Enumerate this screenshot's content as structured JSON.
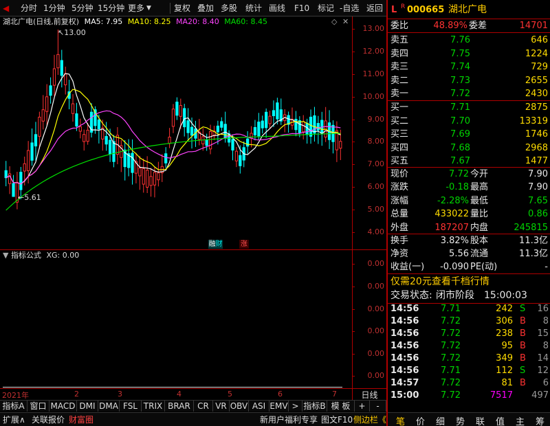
{
  "toolbar": {
    "items": [
      "分时",
      "1分钟",
      "5分钟",
      "15分钟",
      "更多"
    ],
    "right_items": [
      "复权",
      "叠加",
      "多股",
      "统计",
      "画线",
      "F10",
      "标记",
      "-自选",
      "返回"
    ]
  },
  "chart": {
    "title": "湖北广电(日线,前复权)",
    "ma5": "MA5: 7.95",
    "ma10": "MA10: 8.25",
    "ma20": "MA20: 8.40",
    "ma60": "MA60: 8.45",
    "high_label": "13.00",
    "low_label": "5.61",
    "badge_cai": "财",
    "badge_zhang": "涨",
    "yticks": [
      "13.00",
      "12.00",
      "11.00",
      "10.00",
      "9.00",
      "8.00",
      "7.00",
      "6.00",
      "5.00",
      "4.00"
    ],
    "colors": {
      "ma5": "#ffffff",
      "ma10": "#ffff00",
      "ma20": "#ff44ff",
      "ma60": "#00e000",
      "up": "#ff3232",
      "down": "#00ffff"
    }
  },
  "indicator": {
    "title": "指标公式",
    "value": "XG: 0.00",
    "yticks": [
      "0.00",
      "0.00",
      "0.00",
      "0.00",
      "0.00",
      "0.00",
      "0.00"
    ]
  },
  "dates": {
    "labels": [
      "2021年",
      "2",
      "3",
      "4",
      "5",
      "6",
      "7"
    ],
    "period": "日线"
  },
  "tabs": [
    "指标A",
    "窗口",
    "MACD",
    "DMI",
    "DMA",
    "FSL",
    "TRIX",
    "BRAR",
    "CR",
    "VR",
    "OBV",
    "ASI",
    "EMV",
    ">",
    "指标B",
    "模 板",
    "+",
    "-"
  ],
  "status_bar": {
    "left": [
      "扩展∧",
      "关联报价",
      "财富圈"
    ],
    "right": [
      "新用户福利专享",
      "图文F10",
      "侧边栏《"
    ]
  },
  "quote": {
    "flag": "L",
    "code": "000665",
    "name": "湖北广电",
    "weibi_label": "委比",
    "weibi": "48.89%",
    "weicha_label": "委差",
    "weicha": "14701",
    "asks": [
      {
        "label": "卖五",
        "price": "7.76",
        "vol": "646"
      },
      {
        "label": "卖四",
        "price": "7.75",
        "vol": "1224"
      },
      {
        "label": "卖三",
        "price": "7.74",
        "vol": "729"
      },
      {
        "label": "卖二",
        "price": "7.73",
        "vol": "2655"
      },
      {
        "label": "卖一",
        "price": "7.72",
        "vol": "2430"
      }
    ],
    "bids": [
      {
        "label": "买一",
        "price": "7.71",
        "vol": "2875"
      },
      {
        "label": "买二",
        "price": "7.70",
        "vol": "13319"
      },
      {
        "label": "买三",
        "price": "7.69",
        "vol": "1746"
      },
      {
        "label": "买四",
        "price": "7.68",
        "vol": "2968"
      },
      {
        "label": "买五",
        "price": "7.67",
        "vol": "1477"
      }
    ],
    "stats": [
      {
        "l1": "现价",
        "v1": "7.72",
        "c1": "green",
        "l2": "今开",
        "v2": "7.90",
        "c2": "white"
      },
      {
        "l1": "涨跌",
        "v1": "-0.18",
        "c1": "green",
        "l2": "最高",
        "v2": "7.90",
        "c2": "white"
      },
      {
        "l1": "涨幅",
        "v1": "-2.28%",
        "c1": "green",
        "l2": "最低",
        "v2": "7.65",
        "c2": "green"
      },
      {
        "l1": "总量",
        "v1": "433022",
        "c1": "yellow",
        "l2": "量比",
        "v2": "0.86",
        "c2": "green"
      },
      {
        "l1": "外盘",
        "v1": "187207",
        "c1": "red",
        "l2": "内盘",
        "v2": "245815",
        "c2": "green"
      }
    ],
    "fundamentals": [
      {
        "l1": "换手",
        "v1": "3.82%",
        "l2": "股本",
        "v2": "11.3亿"
      },
      {
        "l1": "净资",
        "v1": "5.56",
        "l2": "流通",
        "v2": "11.3亿"
      },
      {
        "l1": "收益(一)",
        "v1": "-0.090",
        "l2": "PE(动)",
        "v2": "-"
      }
    ],
    "promo": "仅需20元查看千档行情",
    "trade_status_label": "交易状态:",
    "trade_status": "闭市阶段",
    "trade_time": "15:00:03",
    "ticks": [
      {
        "t": "14:56",
        "p": "7.71",
        "v": "242",
        "d": "S",
        "n": "16"
      },
      {
        "t": "14:56",
        "p": "7.72",
        "v": "306",
        "d": "B",
        "n": "8"
      },
      {
        "t": "14:56",
        "p": "7.72",
        "v": "238",
        "d": "B",
        "n": "15"
      },
      {
        "t": "14:56",
        "p": "7.72",
        "v": "95",
        "d": "B",
        "n": "8"
      },
      {
        "t": "14:56",
        "p": "7.72",
        "v": "349",
        "d": "B",
        "n": "14"
      },
      {
        "t": "14:56",
        "p": "7.71",
        "v": "112",
        "d": "S",
        "n": "12"
      },
      {
        "t": "14:57",
        "p": "7.72",
        "v": "81",
        "d": "B",
        "n": "6"
      },
      {
        "t": "15:00",
        "p": "7.72",
        "v": "7517",
        "d": "",
        "n": "497"
      }
    ],
    "bottom_tabs": [
      "笔",
      "价",
      "细",
      "势",
      "联",
      "值",
      "主",
      "筹"
    ]
  }
}
